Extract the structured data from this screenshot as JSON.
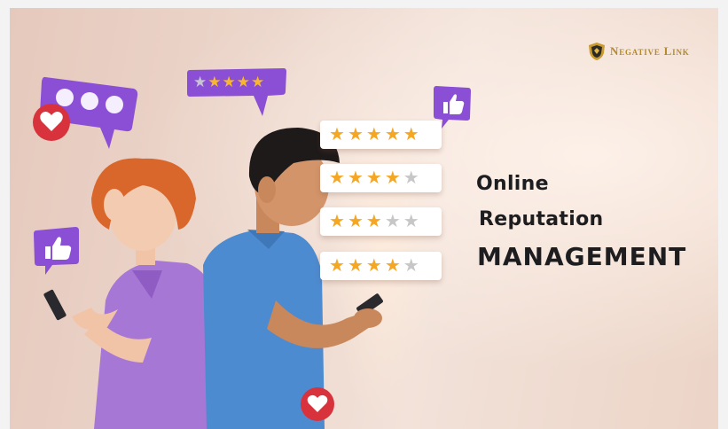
{
  "brand": {
    "name": "Negative Link",
    "accent": "#b48a2a"
  },
  "heading": {
    "line1": "Online",
    "line2": "Reputation",
    "line3": "MANAGEMENT"
  },
  "ratings": [
    {
      "stars": 5,
      "of": 5
    },
    {
      "stars": 4,
      "of": 5
    },
    {
      "stars": 3,
      "of": 5
    },
    {
      "stars": 4,
      "of": 5
    }
  ],
  "bubble_rating": {
    "stars": 4,
    "of": 5
  },
  "icons": [
    "chat-bubble-icon",
    "heart-icon",
    "thumbs-up-icon",
    "star-icon",
    "logo-icon"
  ],
  "colors": {
    "purple": "#8b4fd6",
    "heart_red": "#d8323c",
    "star": "#f5a623"
  }
}
